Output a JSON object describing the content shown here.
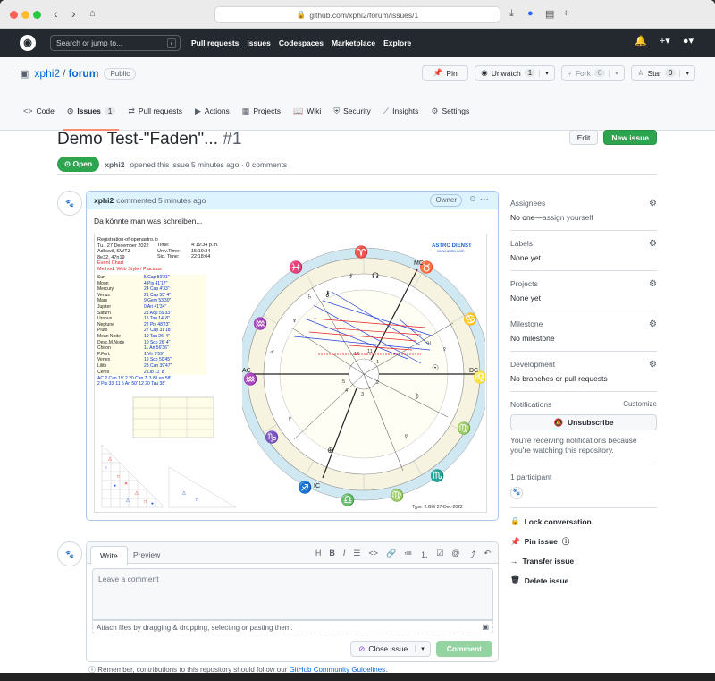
{
  "browser": {
    "url": "github.com/xphi2/forum/issues/1"
  },
  "header": {
    "search_placeholder": "Search or jump to...",
    "slash": "/",
    "nav": [
      "Pull requests",
      "Issues",
      "Codespaces",
      "Marketplace",
      "Explore"
    ]
  },
  "repo": {
    "owner": "xphi2",
    "name": "forum",
    "visibility": "Public",
    "actions": {
      "pin": "Pin",
      "unwatch": "Unwatch",
      "unwatch_count": "1",
      "fork": "Fork",
      "fork_count": "0",
      "star": "Star",
      "star_count": "0"
    },
    "tabs": [
      {
        "label": "Code",
        "icon": "code-icon"
      },
      {
        "label": "Issues",
        "count": "1",
        "icon": "issue-icon"
      },
      {
        "label": "Pull requests",
        "icon": "pr-icon"
      },
      {
        "label": "Actions",
        "icon": "play-icon"
      },
      {
        "label": "Projects",
        "icon": "table-icon"
      },
      {
        "label": "Wiki",
        "icon": "book-icon"
      },
      {
        "label": "Security",
        "icon": "shield-icon"
      },
      {
        "label": "Insights",
        "icon": "graph-icon"
      },
      {
        "label": "Settings",
        "icon": "gear-icon"
      }
    ]
  },
  "issue": {
    "title": "Demo Test-\"Faden\"...",
    "number": "#1",
    "edit": "Edit",
    "new_issue": "New issue",
    "state": "Open",
    "author": "xphi2",
    "meta": "opened this issue 5 minutes ago · 0 comments"
  },
  "comment": {
    "author": "xphi2",
    "time": "commented 5 minutes ago",
    "role": "Owner",
    "body": "Da könnte man was schreiben...",
    "chart": {
      "header_lines": [
        "Registration-of-openastro.io",
        "Tu., 27 December 2022",
        "Adliswil, SWTZ",
        "8e32, 47n19"
      ],
      "time_lines": [
        "Time:",
        "Univ.Time:",
        "Sid. Time:"
      ],
      "time_vals": [
        "4:19:34 p.m.",
        "15:19:34",
        "22:18:04"
      ],
      "event": "Event Chart",
      "method": "Method: Web Style / Placidus",
      "brand": "ASTRO DIENST",
      "brand_url": "www.astro.com",
      "planets": [
        [
          "Sun",
          "5 Cap 50'21\""
        ],
        [
          "Moon",
          "4 Pis 41'17\""
        ],
        [
          "Mercury",
          "24 Cap 4'33\""
        ],
        [
          "Venus",
          "21 Cap 55' 4\""
        ],
        [
          "Mars",
          "9 Gem 53'30\""
        ],
        [
          "Jupiter",
          "0 Ari 41'34\""
        ],
        [
          "Saturn",
          "21 Aqu 59'33\""
        ],
        [
          "Uranus",
          "15 Tau 14' 8\""
        ],
        [
          "Neptune",
          "22 Pis 48'23\""
        ],
        [
          "Pluto",
          "27 Cap 31'18\""
        ],
        [
          "Mean Node",
          "10 Tau 26' 4\""
        ],
        [
          "Desc.M.Node",
          "10 Sco 26' 4\""
        ],
        [
          "Chiron",
          "11 Ari 56'36\""
        ],
        [
          "P.Fort.",
          "1 Vir 9'59\""
        ],
        [
          "Vertex",
          "19 Sco 50'45\""
        ],
        [
          "Lilith",
          "28 Can 39'47\""
        ],
        [
          "Ceres",
          "2 Lib 11' 8\""
        ]
      ],
      "houses": [
        "AC 2 Can 19'  2 20 Can  7'  3 8 Leo 58'",
        "2 Pis 33'  11 5 Ari 50' 12 20 Tau 38'"
      ],
      "labels": {
        "mc": "MC",
        "ic": "IC",
        "ac": "AC",
        "dc": "DC"
      },
      "footer": "Type: 2.GW  27-Dec-2022"
    }
  },
  "composer": {
    "write": "Write",
    "preview": "Preview",
    "placeholder": "Leave a comment",
    "attach": "Attach files by dragging & dropping, selecting or pasting them.",
    "close": "Close issue",
    "comment": "Comment"
  },
  "guide": {
    "text": "Remember, contributions to this repository should follow our",
    "link": "GitHub Community Guidelines",
    "end": "."
  },
  "sidebar": {
    "assignees": {
      "title": "Assignees",
      "value_prefix": "No one—",
      "value_link": "assign yourself"
    },
    "labels": {
      "title": "Labels",
      "value": "None yet"
    },
    "projects": {
      "title": "Projects",
      "value": "None yet"
    },
    "milestone": {
      "title": "Milestone",
      "value": "No milestone"
    },
    "development": {
      "title": "Development",
      "value": "No branches or pull requests"
    },
    "notifications": {
      "title": "Notifications",
      "customize": "Customize",
      "button": "Unsubscribe",
      "note": "You're receiving notifications because you're watching this repository."
    },
    "participants": {
      "title": "1 participant"
    },
    "actions": [
      "Lock conversation",
      "Pin issue",
      "Transfer issue",
      "Delete issue"
    ]
  },
  "colors": {
    "open": "#2da44e",
    "header": "#24292f",
    "link": "#0969da",
    "tab_underline": "#fd8c73"
  }
}
